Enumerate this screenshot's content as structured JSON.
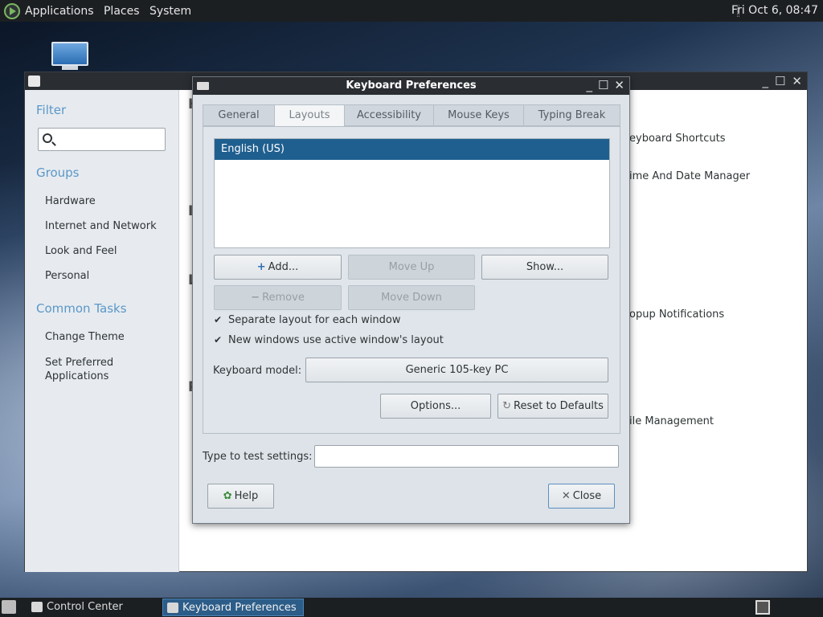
{
  "top_panel": {
    "menus": [
      "Applications",
      "Places",
      "System"
    ],
    "clock": "Fri Oct  6, 08:47"
  },
  "control_center": {
    "sidebar": {
      "filter_heading": "Filter",
      "search_placeholder": "",
      "groups_heading": "Groups",
      "groups": [
        "Hardware",
        "Internet and Network",
        "Look and Feel",
        "Personal"
      ],
      "common_tasks_heading": "Common Tasks",
      "common_tasks": [
        "Change Theme",
        "Set Preferred Applications"
      ]
    },
    "main_items": [
      "eyboard Shortcuts",
      "ime And Date Manager",
      "opup Notifications",
      "ile Management"
    ],
    "section_letters": [
      "H",
      "I",
      "L",
      "P"
    ]
  },
  "keyboard_preferences": {
    "title": "Keyboard Preferences",
    "tabs": [
      "General",
      "Layouts",
      "Accessibility",
      "Mouse Keys",
      "Typing Break"
    ],
    "active_tab": "Layouts",
    "layouts": [
      "English (US)"
    ],
    "buttons": {
      "add": "Add...",
      "move_up": "Move Up",
      "show": "Show...",
      "remove": "Remove",
      "move_down": "Move Down",
      "options": "Options...",
      "reset": "Reset to Defaults",
      "help": "Help",
      "close": "Close"
    },
    "checkboxes": {
      "separate_layout": "Separate layout for each window",
      "new_windows": "New windows use active window's layout"
    },
    "keyboard_model_label": "Keyboard model:",
    "keyboard_model_value": "Generic 105-key PC",
    "test_label": "Type to test settings:",
    "test_value": ""
  },
  "bottom_panel": {
    "tasks": [
      "Control Center",
      "Keyboard Preferences"
    ],
    "active_task": "Keyboard Preferences"
  },
  "colors": {
    "selection": "#1f5f8f",
    "panel": "#1c1f22",
    "sidebar_heading": "#5b97c8"
  }
}
